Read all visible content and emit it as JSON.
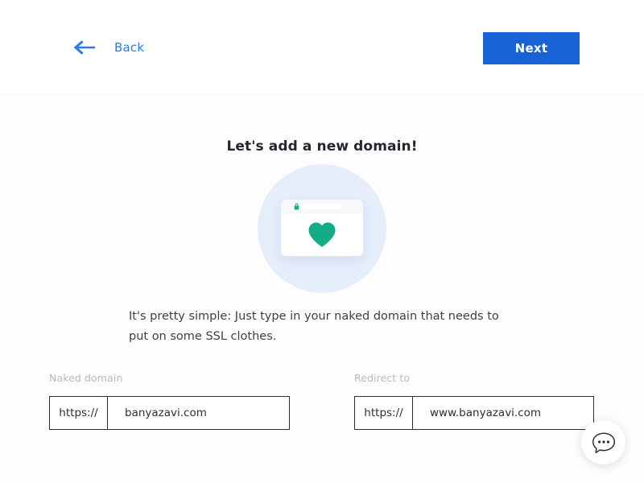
{
  "header": {
    "back_label": "Back",
    "back_icon": "arrow-left-icon",
    "next_label": "Next",
    "accent_color": "#1762d4",
    "link_color": "#2f7ae5"
  },
  "main": {
    "title": "Let's add a new domain!",
    "description": "It's pretty simple: Just type in your naked domain that needs to put on some SSL clothes."
  },
  "illustration": {
    "circle_color": "#e6eefb",
    "card_color": "#ffffff",
    "heart_icon": "heart-icon",
    "heart_color": "#15ac85",
    "lock_icon": "lock-icon",
    "lock_color": "#15ac85"
  },
  "form": {
    "fields": [
      {
        "label": "Naked domain",
        "prefix": "https://",
        "value": "banyazavi.com",
        "placeholder": "banyazavi.com"
      },
      {
        "label": "Redirect to",
        "prefix": "https://",
        "value": "www.banyazavi.com",
        "placeholder": "www.banyazavi.com"
      }
    ]
  },
  "chat": {
    "icon": "chat-bubble-icon",
    "color": "#2b2f38"
  }
}
